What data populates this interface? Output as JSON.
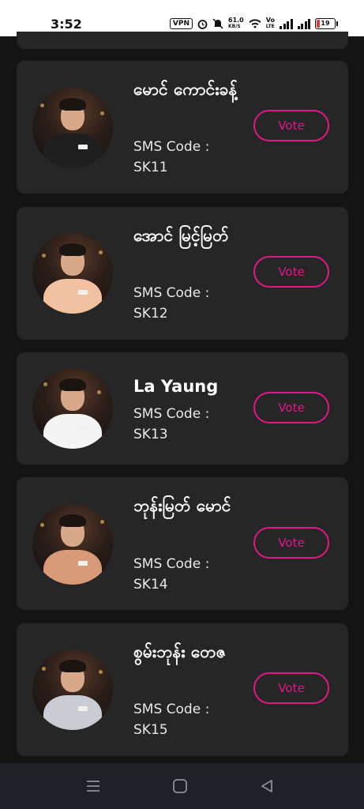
{
  "status_bar": {
    "time": "3:52",
    "vpn": "VPN",
    "speed_value": "61.0",
    "speed_unit": "KB/S",
    "volte_top": "Vo",
    "volte_bottom": "LTE",
    "battery": "19"
  },
  "contestants": [
    {
      "name": "မောင် ကောင်းခန့်",
      "sms_label": "SMS Code :",
      "sms_code": "SK11",
      "vote_label": "Vote",
      "shirt_color": "#1f1f1f"
    },
    {
      "name": "အောင် မြင့်မြတ်",
      "sms_label": "SMS Code :",
      "sms_code": "SK12",
      "vote_label": "Vote",
      "shirt_color": "#f2c1a0"
    },
    {
      "name": "La Yaung",
      "sms_label": "SMS Code :",
      "sms_code": "SK13",
      "vote_label": "Vote",
      "shirt_color": "#f4f4f4"
    },
    {
      "name": "ဘုန်းမြတ် မောင်",
      "sms_label": "SMS Code :",
      "sms_code": "SK14",
      "vote_label": "Vote",
      "shirt_color": "#d99a78"
    },
    {
      "name": "စွမ်းဘုန်း တေဇ",
      "sms_label": "SMS Code :",
      "sms_code": "SK15",
      "vote_label": "Vote",
      "shirt_color": "#c9ccd2"
    }
  ],
  "nav": {
    "menu": "menu-icon",
    "home": "home-icon",
    "back": "back-icon"
  },
  "colors": {
    "accent": "#e4168a",
    "card": "#262626",
    "background": "#141414"
  }
}
